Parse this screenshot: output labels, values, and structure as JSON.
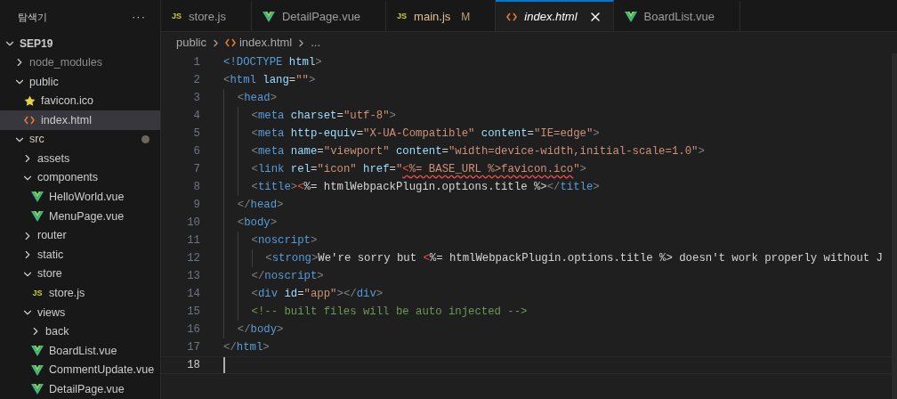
{
  "explorer": {
    "title": "탐색기",
    "more": "···",
    "tree": [
      {
        "name": "SEP19",
        "kind": "root",
        "expanded": true,
        "selected": false,
        "ignored": false,
        "modified": false,
        "children": [
          {
            "name": "node_modules",
            "kind": "folder",
            "expanded": false,
            "selected": false,
            "ignored": true,
            "modified": false
          },
          {
            "name": "public",
            "kind": "folder",
            "expanded": true,
            "selected": false,
            "ignored": false,
            "modified": false,
            "children": [
              {
                "name": "favicon.ico",
                "kind": "star",
                "selected": false,
                "ignored": false,
                "modified": false
              },
              {
                "name": "index.html",
                "kind": "html",
                "selected": true,
                "ignored": false,
                "modified": false
              }
            ]
          },
          {
            "name": "src",
            "kind": "folder",
            "expanded": true,
            "selected": false,
            "ignored": false,
            "modified": true,
            "children": [
              {
                "name": "assets",
                "kind": "folder",
                "expanded": false,
                "selected": false,
                "ignored": false,
                "modified": false
              },
              {
                "name": "components",
                "kind": "folder",
                "expanded": true,
                "selected": false,
                "ignored": false,
                "modified": false,
                "children": [
                  {
                    "name": "HelloWorld.vue",
                    "kind": "vue",
                    "selected": false,
                    "ignored": false,
                    "modified": false
                  },
                  {
                    "name": "MenuPage.vue",
                    "kind": "vue",
                    "selected": false,
                    "ignored": false,
                    "modified": false
                  }
                ]
              },
              {
                "name": "router",
                "kind": "folder",
                "expanded": false,
                "selected": false,
                "ignored": false,
                "modified": false
              },
              {
                "name": "static",
                "kind": "folder",
                "expanded": false,
                "selected": false,
                "ignored": false,
                "modified": false
              },
              {
                "name": "store",
                "kind": "folder",
                "expanded": true,
                "selected": false,
                "ignored": false,
                "modified": false,
                "children": [
                  {
                    "name": "store.js",
                    "kind": "js",
                    "glyph": "JS",
                    "selected": false,
                    "ignored": false,
                    "modified": false
                  }
                ]
              },
              {
                "name": "views",
                "kind": "folder",
                "expanded": true,
                "selected": false,
                "ignored": false,
                "modified": false,
                "children": [
                  {
                    "name": "back",
                    "kind": "folder",
                    "expanded": false,
                    "selected": false,
                    "ignored": false,
                    "modified": false
                  },
                  {
                    "name": "BoardList.vue",
                    "kind": "vue",
                    "selected": false,
                    "ignored": false,
                    "modified": false
                  },
                  {
                    "name": "CommentUpdate.vue",
                    "kind": "vue",
                    "selected": false,
                    "ignored": false,
                    "modified": false
                  },
                  {
                    "name": "DetailPage.vue",
                    "kind": "vue",
                    "selected": false,
                    "ignored": false,
                    "modified": false
                  }
                ]
              }
            ]
          }
        ]
      }
    ]
  },
  "tabs": [
    {
      "label": "store.js",
      "kind": "js",
      "glyph": "JS",
      "selected": false
    },
    {
      "label": "DetailPage.vue",
      "kind": "vue",
      "selected": false
    },
    {
      "label": "main.js",
      "kind": "js",
      "glyph": "JS",
      "git_status": "M",
      "selected": false
    },
    {
      "label": "index.html",
      "kind": "html",
      "selected": true
    },
    {
      "label": "BoardList.vue",
      "kind": "vue",
      "selected": false
    }
  ],
  "breadcrumb": [
    {
      "label": "public",
      "kind": "folder"
    },
    {
      "label": "index.html",
      "kind": "html"
    },
    {
      "label": "...",
      "kind": "more"
    }
  ],
  "code": [
    {
      "number": "1",
      "current": false,
      "tokens": [
        {
          "text": "<!DOCTYPE",
          "kind": "doc"
        },
        {
          "text": " html",
          "kind": "attr"
        },
        {
          "text": ">",
          "kind": "p"
        }
      ]
    },
    {
      "number": "2",
      "current": false,
      "tokens": [
        {
          "text": "<",
          "kind": "p"
        },
        {
          "text": "html",
          "kind": "tag"
        },
        {
          "text": " lang",
          "kind": "attr"
        },
        {
          "text": "=",
          "kind": "txt"
        },
        {
          "text": "\"\"",
          "kind": "str"
        },
        {
          "text": ">",
          "kind": "p"
        }
      ]
    },
    {
      "number": "3",
      "current": false,
      "tokens": [
        {
          "text": "  <",
          "kind": "p"
        },
        {
          "text": "head",
          "kind": "tag"
        },
        {
          "text": ">",
          "kind": "p"
        }
      ]
    },
    {
      "number": "4",
      "current": false,
      "tokens": [
        {
          "text": "    <",
          "kind": "p"
        },
        {
          "text": "meta",
          "kind": "tag"
        },
        {
          "text": " charset",
          "kind": "attr"
        },
        {
          "text": "=",
          "kind": "txt"
        },
        {
          "text": "\"utf-8\"",
          "kind": "str"
        },
        {
          "text": ">",
          "kind": "p"
        }
      ]
    },
    {
      "number": "5",
      "current": false,
      "tokens": [
        {
          "text": "    <",
          "kind": "p"
        },
        {
          "text": "meta",
          "kind": "tag"
        },
        {
          "text": " http-equiv",
          "kind": "attr"
        },
        {
          "text": "=",
          "kind": "txt"
        },
        {
          "text": "\"X-UA-Compatible\"",
          "kind": "str"
        },
        {
          "text": " content",
          "kind": "attr"
        },
        {
          "text": "=",
          "kind": "txt"
        },
        {
          "text": "\"IE=edge\"",
          "kind": "str"
        },
        {
          "text": ">",
          "kind": "p"
        }
      ]
    },
    {
      "number": "6",
      "current": false,
      "tokens": [
        {
          "text": "    <",
          "kind": "p"
        },
        {
          "text": "meta",
          "kind": "tag"
        },
        {
          "text": " name",
          "kind": "attr"
        },
        {
          "text": "=",
          "kind": "txt"
        },
        {
          "text": "\"viewport\"",
          "kind": "str"
        },
        {
          "text": " content",
          "kind": "attr"
        },
        {
          "text": "=",
          "kind": "txt"
        },
        {
          "text": "\"width=device-width,initial-scale=1.0\"",
          "kind": "str"
        },
        {
          "text": ">",
          "kind": "p"
        }
      ]
    },
    {
      "number": "7",
      "current": false,
      "tokens": [
        {
          "text": "    <",
          "kind": "p"
        },
        {
          "text": "link",
          "kind": "tag"
        },
        {
          "text": " rel",
          "kind": "attr"
        },
        {
          "text": "=",
          "kind": "txt"
        },
        {
          "text": "\"icon\"",
          "kind": "str"
        },
        {
          "text": " href",
          "kind": "attr"
        },
        {
          "text": "=",
          "kind": "txt"
        },
        {
          "text": "\"",
          "kind": "str"
        },
        {
          "text": "<",
          "kind": "error"
        },
        {
          "text": "%= BASE_URL %>favicon.ico",
          "kind": "squiggle"
        },
        {
          "text": "\"",
          "kind": "str"
        },
        {
          "text": ">",
          "kind": "p"
        }
      ]
    },
    {
      "number": "8",
      "current": false,
      "tokens": [
        {
          "text": "    <",
          "kind": "p"
        },
        {
          "text": "title",
          "kind": "tag"
        },
        {
          "text": ">",
          "kind": "p"
        },
        {
          "text": "<",
          "kind": "invalid"
        },
        {
          "text": "%= htmlWebpackPlugin.options.title %>",
          "kind": "txt"
        },
        {
          "text": "</",
          "kind": "p"
        },
        {
          "text": "title",
          "kind": "tag"
        },
        {
          "text": ">",
          "kind": "p"
        }
      ]
    },
    {
      "number": "9",
      "current": false,
      "tokens": [
        {
          "text": "  </",
          "kind": "p"
        },
        {
          "text": "head",
          "kind": "tag"
        },
        {
          "text": ">",
          "kind": "p"
        }
      ]
    },
    {
      "number": "10",
      "current": false,
      "tokens": [
        {
          "text": "  <",
          "kind": "p"
        },
        {
          "text": "body",
          "kind": "tag"
        },
        {
          "text": ">",
          "kind": "p"
        }
      ]
    },
    {
      "number": "11",
      "current": false,
      "tokens": [
        {
          "text": "    <",
          "kind": "p"
        },
        {
          "text": "noscript",
          "kind": "tag"
        },
        {
          "text": ">",
          "kind": "p"
        }
      ]
    },
    {
      "number": "12",
      "current": false,
      "tokens": [
        {
          "text": "      <",
          "kind": "p"
        },
        {
          "text": "strong",
          "kind": "tag"
        },
        {
          "text": ">",
          "kind": "p"
        },
        {
          "text": "We're sorry but ",
          "kind": "txt"
        },
        {
          "text": "<",
          "kind": "invalid"
        },
        {
          "text": "%= htmlWebpackPlugin.options.title %> doesn't work properly without J",
          "kind": "txt"
        }
      ]
    },
    {
      "number": "13",
      "current": false,
      "tokens": [
        {
          "text": "    </",
          "kind": "p"
        },
        {
          "text": "noscript",
          "kind": "tag"
        },
        {
          "text": ">",
          "kind": "p"
        }
      ]
    },
    {
      "number": "14",
      "current": false,
      "tokens": [
        {
          "text": "    <",
          "kind": "p"
        },
        {
          "text": "div",
          "kind": "tag"
        },
        {
          "text": " id",
          "kind": "attr"
        },
        {
          "text": "=",
          "kind": "txt"
        },
        {
          "text": "\"app\"",
          "kind": "str"
        },
        {
          "text": "></",
          "kind": "p"
        },
        {
          "text": "div",
          "kind": "tag"
        },
        {
          "text": ">",
          "kind": "p"
        }
      ]
    },
    {
      "number": "15",
      "current": false,
      "tokens": [
        {
          "text": "    <!-- built files will be auto injected -->",
          "kind": "cmt"
        }
      ]
    },
    {
      "number": "16",
      "current": false,
      "tokens": [
        {
          "text": "  </",
          "kind": "p"
        },
        {
          "text": "body",
          "kind": "tag"
        },
        {
          "text": ">",
          "kind": "p"
        }
      ]
    },
    {
      "number": "17",
      "current": false,
      "tokens": [
        {
          "text": "</",
          "kind": "p"
        },
        {
          "text": "html",
          "kind": "tag"
        },
        {
          "text": ">",
          "kind": "p"
        }
      ]
    },
    {
      "number": "18",
      "current": true
    }
  ]
}
